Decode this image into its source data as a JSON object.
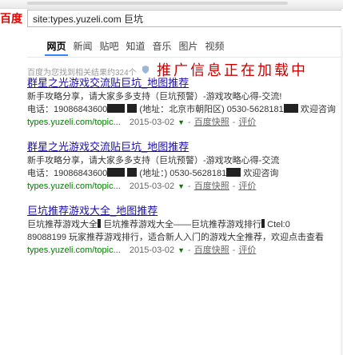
{
  "search": {
    "logo_fragment": "百度",
    "query": "site:types.yuzeli.com 巨坑"
  },
  "tabs": [
    {
      "label": "网页",
      "active": true
    },
    {
      "label": "新闻"
    },
    {
      "label": "贴吧"
    },
    {
      "label": "知道"
    },
    {
      "label": "音乐"
    },
    {
      "label": "图片"
    },
    {
      "label": "视频"
    }
  ],
  "results_count": "百度为您找到相关结果约324个",
  "ad_banner": "推广信息正在加载中",
  "results": [
    {
      "title": "群星之光游戏交流贴巨坑_地图推荐",
      "abstract_pre": "新手攻略分享，请大家多多支持（巨坑预警）-游戏攻略心得-交流!",
      "abstract_phone": "电话：19086843600",
      "abstract_mid": "(地址：北京市朝阳区) 0530-5628181",
      "abstract_tail": "欢迎咨询",
      "url": "types.yuzeli.com/topic...",
      "date": "2015-03-02",
      "snapshot": "百度快照",
      "comments": "评价"
    },
    {
      "title": "群星之光游戏交流贴巨坑_地图推荐",
      "abstract_pre": "新手攻略分享，请大家多多支持（巨坑预警）-游戏攻略心得-交流",
      "abstract_phone": "电话：19086843600",
      "abstract_mid": "(地址：) 0530-5628181",
      "abstract_tail": "欢迎咨询",
      "url": "types.yuzeli.com/topic...",
      "date": "2015-03-02",
      "snapshot": "百度快照",
      "comments": "评价"
    },
    {
      "title": "巨坑推荐游戏大全_地图推荐",
      "abstract_pre": "巨坑推荐游戏大全",
      "abstract_phone": "巨坑推荐游戏大全——巨坑推荐游戏排行",
      "abstract_mid": "Ctel:0",
      "abstract_tail": "89088199 玩家推荐游戏排行，适合新人入门的游戏大全推荐，欢迎点击查看",
      "url": "types.yuzeli.com/topic...",
      "date": "2015-03-02",
      "snapshot": "百度快照",
      "comments": "评价"
    }
  ],
  "colors": {
    "link": "#1a0dab",
    "url": "#008000",
    "highlight": "#cc0000",
    "active_tab_underline": "#3385ff"
  }
}
